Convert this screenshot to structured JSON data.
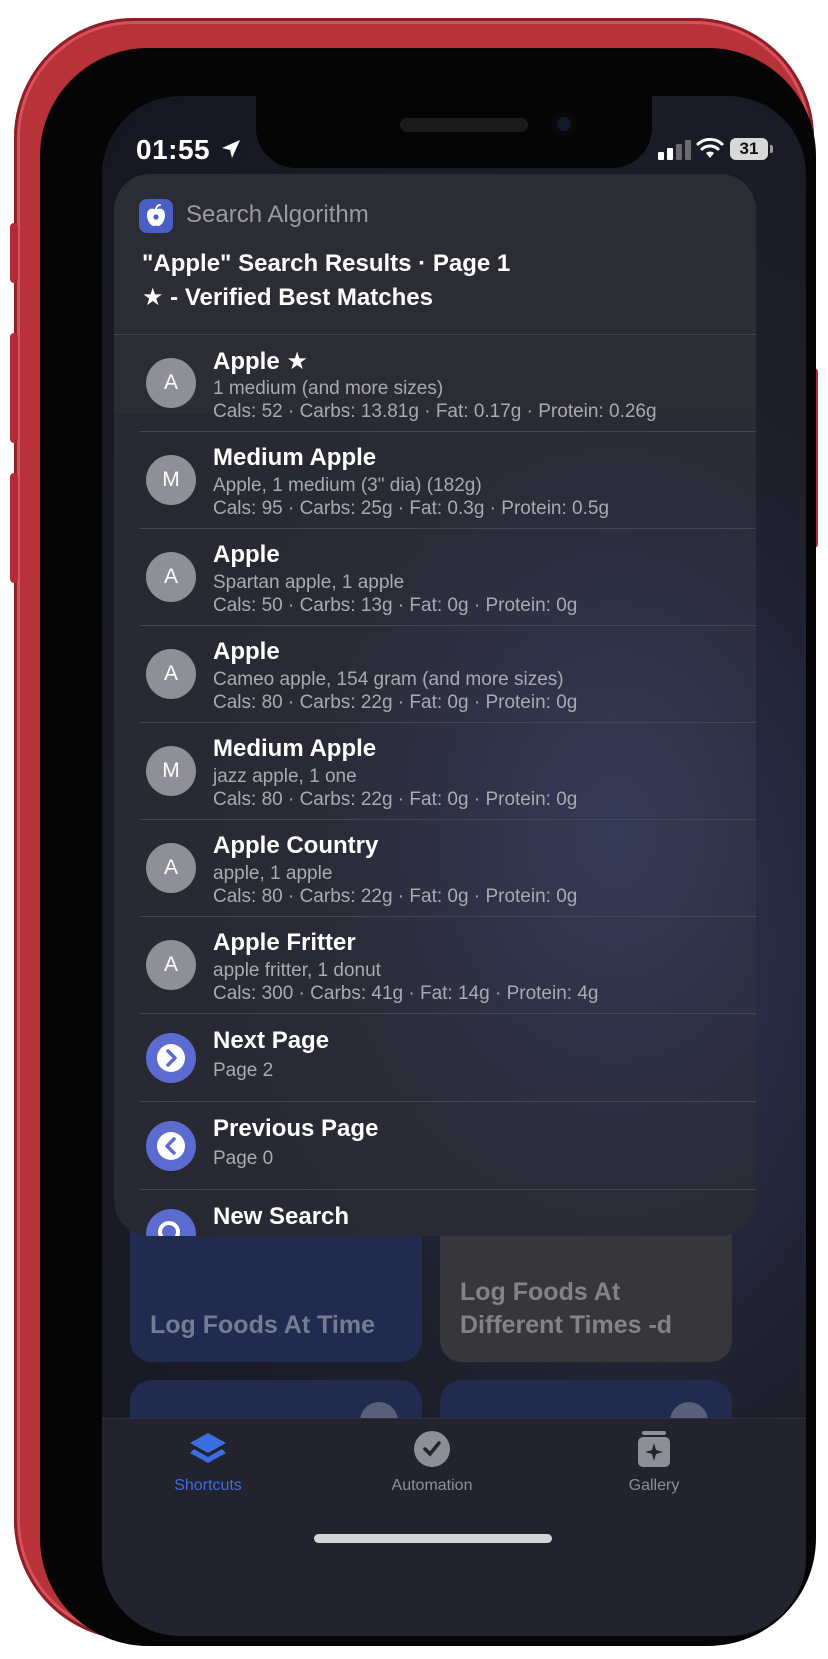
{
  "status_bar": {
    "time": "01:55",
    "battery": "31"
  },
  "panel": {
    "app_name": "Search Algorithm",
    "title": "\"Apple\" Search Results · Page 1",
    "legend": "★ - Verified Best Matches",
    "results": [
      {
        "avatar": "A",
        "name": "Apple ★",
        "detail": "1 medium (and more sizes)",
        "macros": "Cals: 52 · Carbs: 13.81g · Fat: 0.17g · Protein: 0.26g"
      },
      {
        "avatar": "M",
        "name": "Medium Apple",
        "detail": "Apple, 1 medium (3\" dia) (182g)",
        "macros": "Cals: 95 · Carbs: 25g · Fat: 0.3g · Protein: 0.5g"
      },
      {
        "avatar": "A",
        "name": "Apple",
        "detail": "Spartan apple, 1 apple",
        "macros": "Cals: 50 · Carbs: 13g · Fat: 0g · Protein: 0g"
      },
      {
        "avatar": "A",
        "name": "Apple",
        "detail": "Cameo apple, 154 gram (and more sizes)",
        "macros": "Cals: 80 · Carbs: 22g · Fat: 0g · Protein: 0g"
      },
      {
        "avatar": "M",
        "name": "Medium Apple",
        "detail": "jazz apple, 1 one",
        "macros": "Cals: 80 · Carbs: 22g · Fat: 0g · Protein: 0g"
      },
      {
        "avatar": "A",
        "name": "Apple Country",
        "detail": "apple, 1 apple",
        "macros": "Cals: 80 · Carbs: 22g · Fat: 0g · Protein: 0g"
      },
      {
        "avatar": "A",
        "name": "Apple Fritter",
        "detail": "apple fritter, 1 donut",
        "macros": "Cals: 300 · Carbs: 41g · Fat: 14g · Protein: 4g"
      }
    ],
    "next_page": {
      "label": "Next Page",
      "sub": "Page 2"
    },
    "previous_page": {
      "label": "Previous Page",
      "sub": "Page 0"
    },
    "new_search": {
      "label": "New Search"
    }
  },
  "background_tiles": {
    "tile1": "Log Foods At Time",
    "tile2_line1": "Log Foods At",
    "tile2_line2": "Different Times -d"
  },
  "tab_bar": {
    "shortcuts": "Shortcuts",
    "automation": "Automation",
    "gallery": "Gallery"
  },
  "colors": {
    "accent": "#3b6fe0",
    "nav_icon": "#5b6bd0",
    "frame": "#b8323a"
  }
}
